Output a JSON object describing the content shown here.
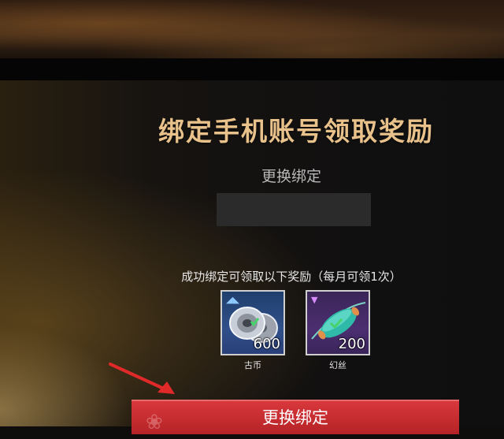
{
  "header": {
    "title": "绑定手机账号领取奖励"
  },
  "binding": {
    "change_link": "更换绑定"
  },
  "rewards": {
    "label": "成功绑定可领取以下奖励（每月可领1次）",
    "items": [
      {
        "name": "古币",
        "quantity": "600",
        "icon": "coin-stack-icon",
        "rarity": "blue"
      },
      {
        "name": "幻丝",
        "quantity": "200",
        "icon": "silk-cocoon-icon",
        "rarity": "purple"
      }
    ]
  },
  "actions": {
    "confirm_label": "更换绑定"
  },
  "colors": {
    "title": "#e9c28b",
    "button": "#c5282c",
    "coin_bg": "#30508a",
    "silk_bg": "#4b2e70",
    "arrow": "#e02a2a"
  }
}
